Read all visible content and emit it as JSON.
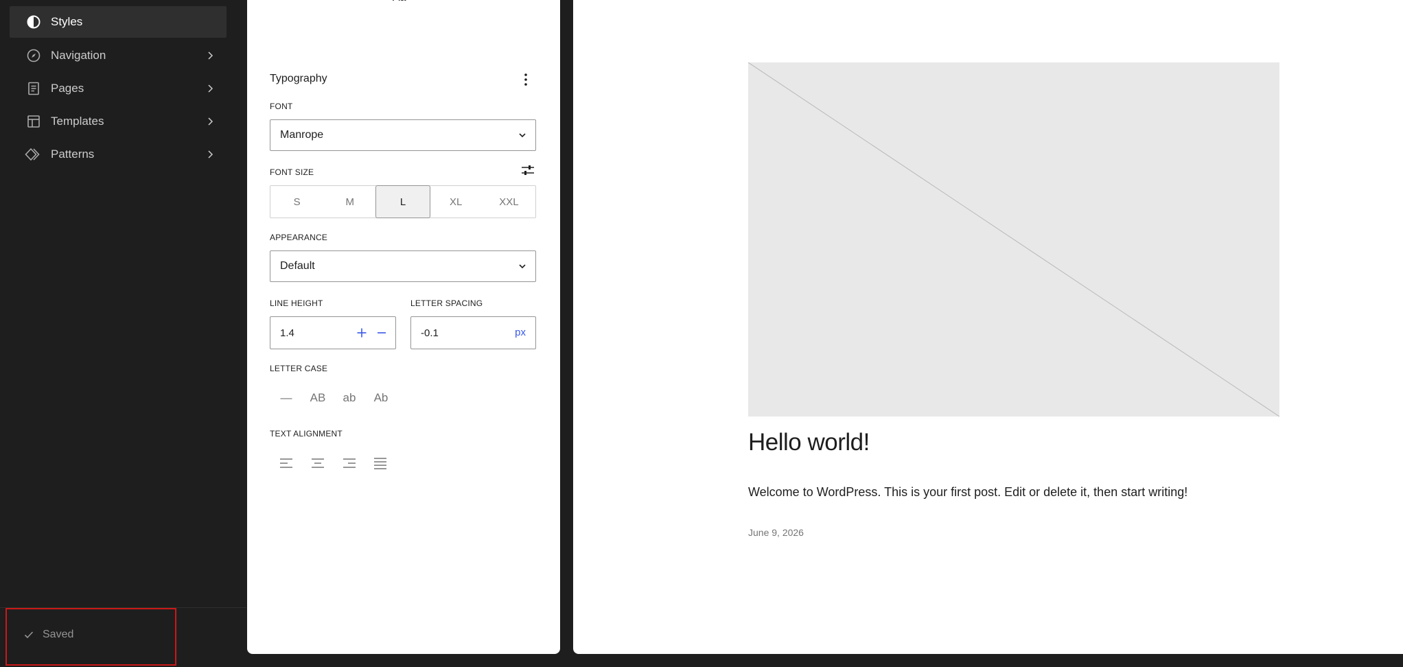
{
  "sidebar": {
    "items": [
      {
        "label": "Styles",
        "icon": "half-circle-icon",
        "active": true
      },
      {
        "label": "Navigation",
        "icon": "compass-icon"
      },
      {
        "label": "Pages",
        "icon": "page-icon"
      },
      {
        "label": "Templates",
        "icon": "layout-icon"
      },
      {
        "label": "Patterns",
        "icon": "diamond-icon"
      }
    ],
    "status": "Saved"
  },
  "panel": {
    "top_fragment": "Aa",
    "section_title": "Typography",
    "font": {
      "label": "FONT",
      "value": "Manrope"
    },
    "font_size": {
      "label": "FONT SIZE",
      "options": [
        "S",
        "M",
        "L",
        "XL",
        "XXL"
      ],
      "selected": "L"
    },
    "appearance": {
      "label": "APPEARANCE",
      "value": "Default"
    },
    "line_height": {
      "label": "LINE HEIGHT",
      "value": "1.4"
    },
    "letter_spacing": {
      "label": "LETTER SPACING",
      "value": "-0.1",
      "unit": "px"
    },
    "letter_case": {
      "label": "LETTER CASE",
      "options": [
        "—",
        "AB",
        "ab",
        "Ab"
      ]
    },
    "text_alignment": {
      "label": "TEXT ALIGNMENT"
    }
  },
  "preview": {
    "post_title": "Hello world!",
    "excerpt": "Welcome to WordPress. This is your first post. Edit or delete it, then start writing!",
    "date": "June 9, 2026"
  },
  "colors": {
    "sidebar_bg": "#1e1e1e",
    "accent": "#3858e9",
    "highlight": "#cc1818"
  }
}
